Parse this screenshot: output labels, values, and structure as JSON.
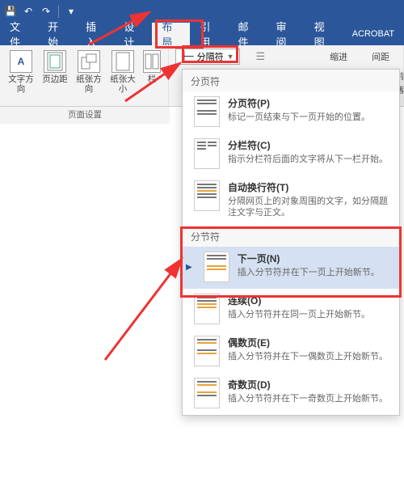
{
  "qat": {
    "save": "💾",
    "undo": "↶",
    "redo": "↷",
    "more": "▾"
  },
  "tabs": {
    "file": "文件",
    "home": "开始",
    "insert": "插入",
    "design": "设计",
    "layout": "布局",
    "refs": "引用",
    "mail": "邮件",
    "review": "审阅",
    "view": "视图",
    "acrobat": "ACROBAT"
  },
  "ribbon": {
    "textdir": "文字方向",
    "margin": "页边距",
    "orient": "纸张方向",
    "size": "纸张大小",
    "columns": "栏",
    "group_pagesetup": "页面设置",
    "breaks": "分隔符",
    "indent": "缩进",
    "spacing": "间距",
    "para_before": "段前",
    "para_after": "段落"
  },
  "dropdown": {
    "section1": "分页符",
    "items1": [
      {
        "title": "分页符(P)",
        "desc": "标记一页结束与下一页开始的位置。"
      },
      {
        "title": "分栏符(C)",
        "desc": "指示分栏符后面的文字将从下一栏开始。"
      },
      {
        "title": "自动换行符(T)",
        "desc": "分隔网页上的对象周围的文字，如分隔题注文字与正文。"
      }
    ],
    "section2": "分节符",
    "items2": [
      {
        "title": "下一页(N)",
        "desc": "插入分节符并在下一页上开始新节。"
      },
      {
        "title": "连续(O)",
        "desc": "插入分节符并在同一页上开始新节。"
      },
      {
        "title": "偶数页(E)",
        "desc": "插入分节符并在下一偶数页上开始新节。"
      },
      {
        "title": "奇数页(D)",
        "desc": "插入分节符并在下一奇数页上开始新节。"
      }
    ]
  }
}
